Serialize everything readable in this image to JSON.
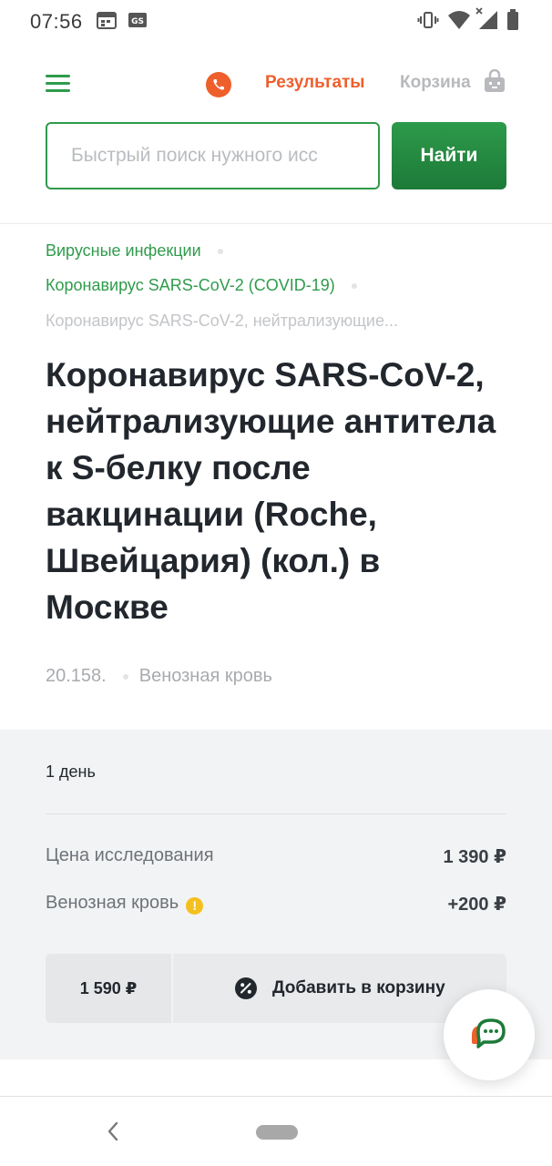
{
  "status_bar": {
    "time": "07:56",
    "icons": [
      "calendar-icon",
      "gs-icon",
      "vibrate-icon",
      "wifi-icon",
      "signal-icon",
      "battery-icon"
    ]
  },
  "header": {
    "menu_icon": "hamburger-menu-icon",
    "phone_icon": "phone-icon",
    "results_label": "Результаты",
    "cart_label": "Корзина",
    "cart_icon": "cart-icon",
    "colors": {
      "brand_green": "#2f9b4b",
      "accent_orange": "#ee5f2c"
    }
  },
  "search": {
    "placeholder": "Быстрый поиск нужного исс",
    "button_label": "Найти"
  },
  "breadcrumbs": [
    {
      "label": "Вирусные инфекции",
      "active": true
    },
    {
      "label": "Коронавирус SARS-CoV-2 (COVID-19)",
      "active": true
    },
    {
      "label": "Коронавирус SARS-CoV-2, нейтрализующие...",
      "active": false
    }
  ],
  "page_title": "Коронавирус SARS-CoV-2, нейтрализующие антитела к S-белку после вакцинации (Roche, Швейцария) (кол.) в Москве",
  "test_meta": {
    "code": "20.158.",
    "biomaterial": "Венозная кровь"
  },
  "pricing": {
    "duration": "1 день",
    "rows": [
      {
        "label": "Цена исследования",
        "value": "1 390 ₽"
      },
      {
        "label": "Венозная кровь",
        "value": "+200 ₽",
        "warning_icon": "exclamation-icon"
      }
    ],
    "total": "1 590 ₽",
    "add_to_cart_label": "Добавить в корзину",
    "add_to_cart_icon": "discount-percent-icon"
  },
  "chat": {
    "icon": "chat-bubble-icon"
  },
  "nav_bar": {
    "back_icon": "back-chevron-icon",
    "home_icon": "home-pill-icon"
  }
}
